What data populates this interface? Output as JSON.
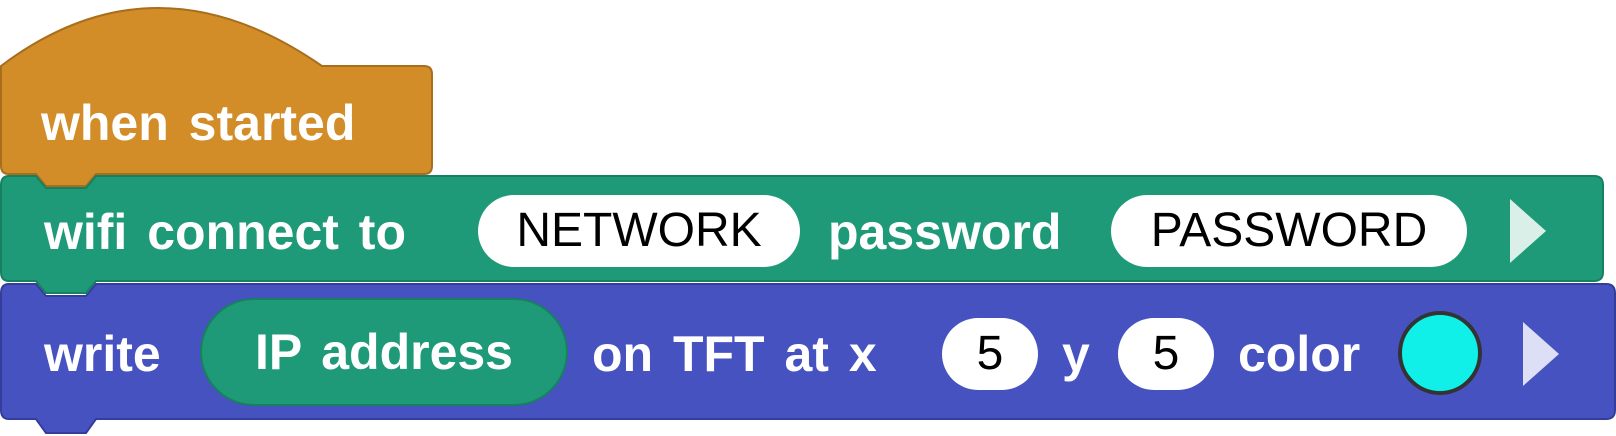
{
  "colors": {
    "hat_fill": "#d28c28",
    "hat_stroke": "#a86e1c",
    "wifi_fill": "#1f9a78",
    "wifi_stroke": "#17805f",
    "tft_fill": "#4652bf",
    "tft_stroke": "#343d9c",
    "reporter_fill": "#1f9a78",
    "swatch": "#10f0e8",
    "arrow_wifi": "#d9efe8",
    "arrow_tft": "#dcdff5"
  },
  "hat_block": {
    "label": "when started"
  },
  "wifi_block": {
    "label": "wifi connect to",
    "network_value": "NETWORK",
    "password_label": "password",
    "password_value": "PASSWORD",
    "expand_icon": "play-triangle-icon"
  },
  "tft_block": {
    "label": "write",
    "reporter_label": "IP address",
    "position_label": "on TFT at x",
    "x_value": "5",
    "y_label": "y",
    "y_value": "5",
    "color_label": "color",
    "expand_icon": "play-triangle-icon"
  }
}
